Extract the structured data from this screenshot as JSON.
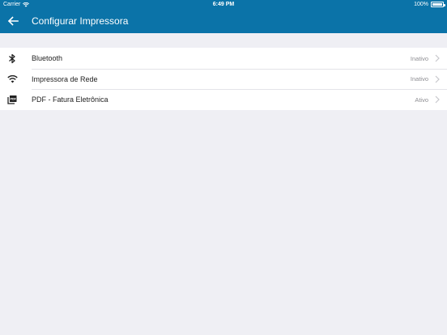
{
  "status_bar": {
    "carrier": "Carrier",
    "time": "6:49 PM",
    "battery": "100%",
    "battery_level": 1.0
  },
  "nav": {
    "title": "Configurar Impressora",
    "back_icon": "arrow-left-icon"
  },
  "printers": [
    {
      "label": "Bluetooth",
      "status": "Inativo",
      "icon": "bluetooth-icon"
    },
    {
      "label": "Impressora de Rede",
      "status": "Inativo",
      "icon": "wifi-icon"
    },
    {
      "label": "PDF - Fatura Eletrônica",
      "status": "Ativo",
      "icon": "pdf-icon"
    }
  ],
  "colors": {
    "accent": "#0b73a8",
    "background": "#efeff4",
    "row_text": "#222222",
    "secondary_text": "#8e8e93"
  }
}
